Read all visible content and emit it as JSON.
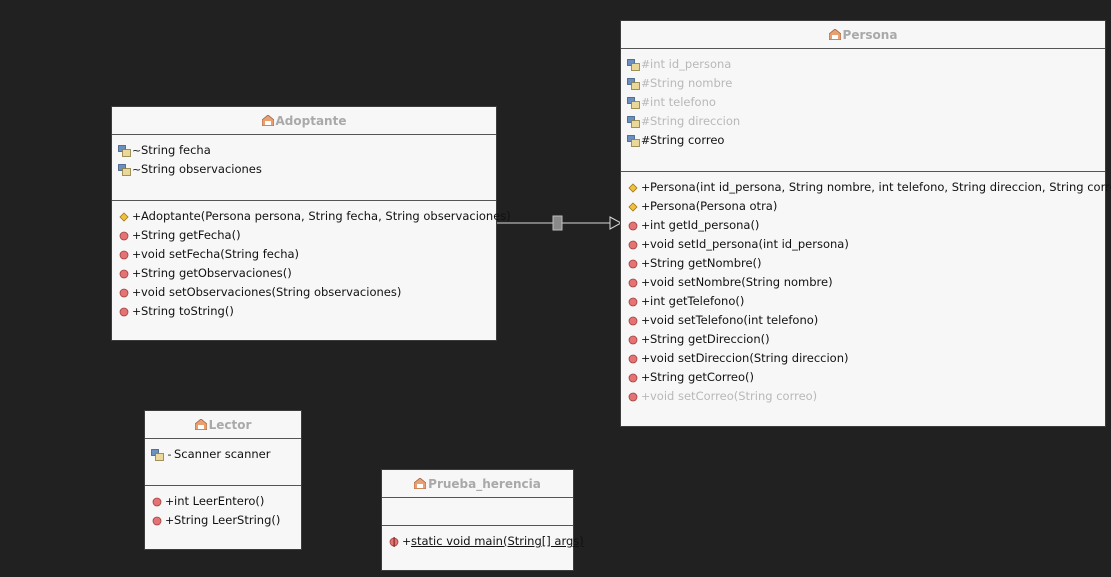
{
  "colors": {
    "background": "#212121",
    "box_fill": "#f7f7f7",
    "title_text": "#a9a9a9",
    "faded_text": "#b8b8b8",
    "method_icon": "#e57373",
    "constructor_icon": "#f0c040",
    "field_icon": "#6a8fc0"
  },
  "classes": {
    "adoptante": {
      "name": "Adoptante",
      "fields": [
        {
          "vis": "~",
          "text": "String fecha"
        },
        {
          "vis": "~",
          "text": "String observaciones"
        }
      ],
      "methods": [
        {
          "vis": "+",
          "text": "Adoptante(Persona persona, String fecha, String observaciones)",
          "icon": "constructor-icon"
        },
        {
          "vis": "+",
          "text": "String getFecha()",
          "icon": "method-icon"
        },
        {
          "vis": "+",
          "text": "void setFecha(String fecha)",
          "icon": "method-icon"
        },
        {
          "vis": "+",
          "text": "String getObservaciones()",
          "icon": "method-icon"
        },
        {
          "vis": "+",
          "text": "void setObservaciones(String observaciones)",
          "icon": "method-icon"
        },
        {
          "vis": "+",
          "text": "String toString()",
          "icon": "method-icon"
        }
      ]
    },
    "persona": {
      "name": "Persona",
      "fields": [
        {
          "vis": "#",
          "text": "int id_persona",
          "faded": true
        },
        {
          "vis": "#",
          "text": "String nombre",
          "faded": true
        },
        {
          "vis": "#",
          "text": "int telefono",
          "faded": true
        },
        {
          "vis": "#",
          "text": "String direccion",
          "faded": true
        },
        {
          "vis": "#",
          "text": "String correo",
          "faded": false
        }
      ],
      "methods": [
        {
          "vis": "+",
          "text": "Persona(int id_persona, String nombre, int telefono, String direccion, String correo)",
          "icon": "constructor-icon"
        },
        {
          "vis": "+",
          "text": "Persona(Persona otra)",
          "icon": "constructor-icon"
        },
        {
          "vis": "+",
          "text": "int getId_persona()",
          "icon": "method-icon"
        },
        {
          "vis": "+",
          "text": "void setId_persona(int id_persona)",
          "icon": "method-icon"
        },
        {
          "vis": "+",
          "text": "String getNombre()",
          "icon": "method-icon"
        },
        {
          "vis": "+",
          "text": "void setNombre(String nombre)",
          "icon": "method-icon"
        },
        {
          "vis": "+",
          "text": "int getTelefono()",
          "icon": "method-icon"
        },
        {
          "vis": "+",
          "text": "void setTelefono(int telefono)",
          "icon": "method-icon"
        },
        {
          "vis": "+",
          "text": "String getDireccion()",
          "icon": "method-icon"
        },
        {
          "vis": "+",
          "text": "void setDireccion(String direccion)",
          "icon": "method-icon"
        },
        {
          "vis": "+",
          "text": "String getCorreo()",
          "icon": "method-icon"
        },
        {
          "vis": "+",
          "text": "void setCorreo(String correo)",
          "icon": "method-icon",
          "faded": true
        }
      ]
    },
    "lector": {
      "name": "Lector",
      "fields": [
        {
          "vis": "-",
          "text": "Scanner scanner"
        }
      ],
      "methods": [
        {
          "vis": "+",
          "text": "int LeerEntero()",
          "icon": "method-icon"
        },
        {
          "vis": "+",
          "text": "String LeerString()",
          "icon": "method-icon"
        }
      ]
    },
    "prueba_herencia": {
      "name": "Prueba_herencia",
      "fields": [],
      "methods": [
        {
          "vis": "+",
          "text": "static void main(String[] args)",
          "icon": "static-method-icon",
          "underline": true
        }
      ]
    }
  },
  "relations": [
    {
      "type": "generalization",
      "from": "Adoptante",
      "to": "Persona"
    }
  ]
}
